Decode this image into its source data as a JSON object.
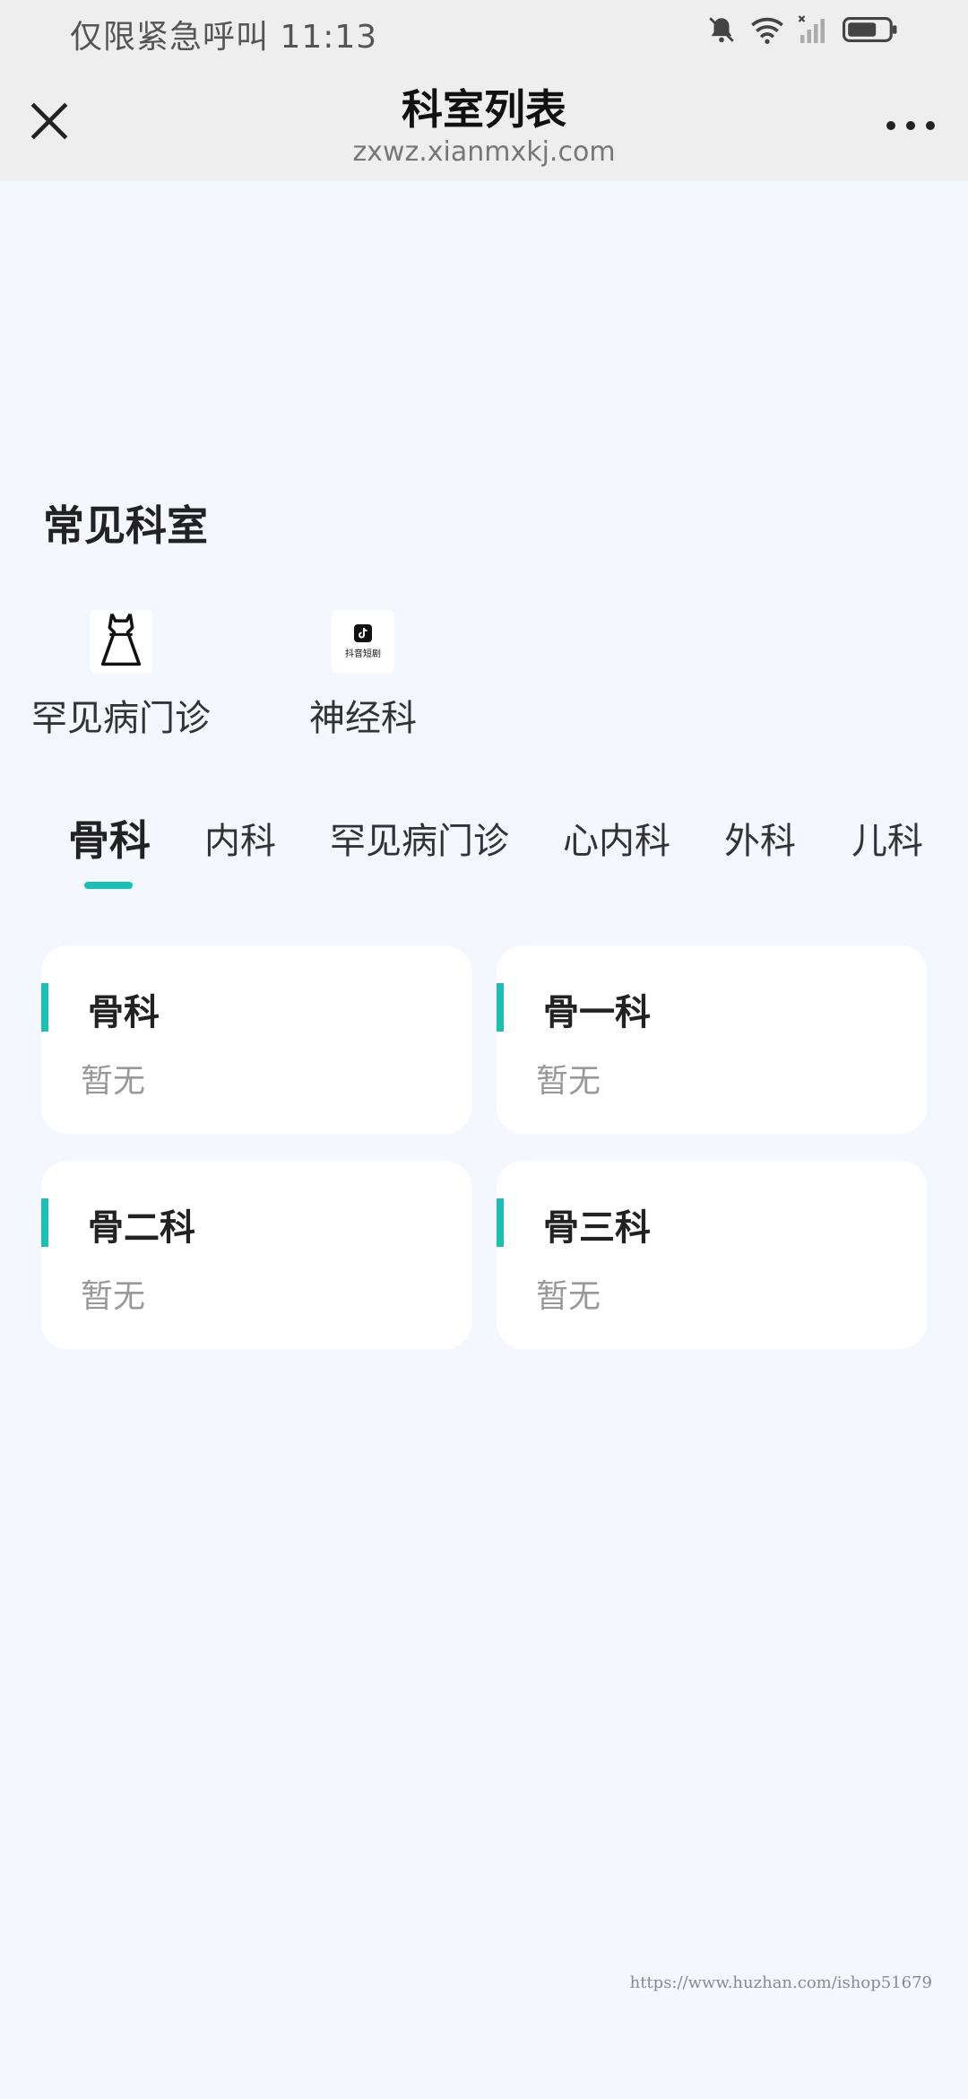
{
  "status_bar": {
    "left_text": "仅限紧急呼叫 11:13",
    "icons": [
      "bell-off-icon",
      "wifi-icon",
      "signal-icon",
      "battery-icon"
    ]
  },
  "nav": {
    "title": "科室列表",
    "subtitle": "zxwz.xianmxkj.com",
    "close_icon": "close-icon",
    "more_icon": "more-icon"
  },
  "common_section": {
    "title": "常见科室",
    "items": [
      {
        "label": "罕见病门诊",
        "icon": "dress-icon"
      },
      {
        "label": "神经科",
        "icon": "app-logo-icon",
        "icon_text": "抖音短剧"
      }
    ]
  },
  "tabs": [
    {
      "label": "骨科",
      "active": true
    },
    {
      "label": "内科"
    },
    {
      "label": "罕见病门诊"
    },
    {
      "label": "心内科"
    },
    {
      "label": "外科"
    },
    {
      "label": "儿科"
    }
  ],
  "cards": [
    {
      "name": "骨科",
      "desc": "暂无"
    },
    {
      "name": "骨一科",
      "desc": "暂无"
    },
    {
      "name": "骨二科",
      "desc": "暂无"
    },
    {
      "name": "骨三科",
      "desc": "暂无"
    }
  ],
  "watermark": "https://www.huzhan.com/ishop51679",
  "colors": {
    "accent": "#1bbfb5",
    "background": "#f4f7fe",
    "header": "#eeeeee"
  }
}
